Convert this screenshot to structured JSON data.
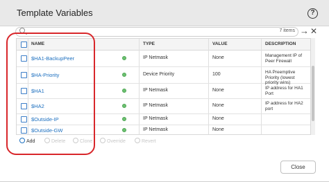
{
  "dialog": {
    "title": "Template Variables",
    "help_icon": "?",
    "items_count": "7 items",
    "go_icon": "→",
    "clear_icon": "✕"
  },
  "columns": {
    "name": "NAME",
    "type": "TYPE",
    "value": "VALUE",
    "description": "DESCRIPTION"
  },
  "rows": [
    {
      "name": "$HA1-BackupPeer",
      "type": "IP Netmask",
      "value": "None",
      "description": "Management IP of Peer Firewall"
    },
    {
      "name": "$HA-Priority",
      "type": "Device Priority",
      "value": "100",
      "description": "HA Preemptive Priority (lowest priority wins)"
    },
    {
      "name": "$HA1",
      "type": "IP Netmask",
      "value": "None",
      "description": "IP address for HA1 Port"
    },
    {
      "name": "$HA2",
      "type": "IP Netmask",
      "value": "None",
      "description": "IP address for HA2 port"
    },
    {
      "name": "$Outside-IP",
      "type": "IP Netmask",
      "value": "None",
      "description": ""
    },
    {
      "name": "$Outside-GW",
      "type": "IP Netmask",
      "value": "None",
      "description": ""
    }
  ],
  "toolbar": {
    "add": "Add",
    "delete": "Delete",
    "clone": "Clone",
    "override": "Override",
    "revert": "Revert"
  },
  "footer": {
    "close": "Close"
  },
  "colors": {
    "link": "#1c6fbf",
    "override_dot": "#6cc070",
    "highlight": "#d8262a"
  }
}
